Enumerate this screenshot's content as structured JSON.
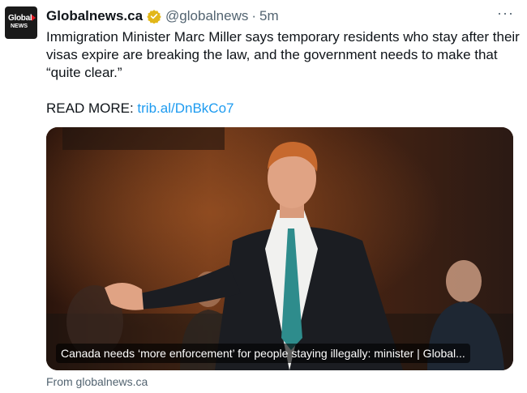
{
  "author": {
    "avatar_text_line1": "Global",
    "avatar_text_line2": "NEWS",
    "display_name": "Globalnews.ca",
    "handle": "@globalnews",
    "separator": "·",
    "timestamp": "5m",
    "verified_badge_color": "#e2b719"
  },
  "more_menu_label": "···",
  "tweet": {
    "text": "Immigration Minister Marc Miller says temporary residents who stay after their visas expire are breaking the law, and the government needs to make that “quite clear.”",
    "read_more_prefix": "READ MORE:",
    "link_text": "trib.al/DnBkCo7"
  },
  "card": {
    "caption": "Canada needs ‘more enforcement’ for people staying illegally: minister | Global...",
    "source": "From globalnews.ca"
  },
  "colors": {
    "link": "#1d9bf0",
    "secondary_text": "#536471",
    "avatar_accent": "#e31b23"
  }
}
